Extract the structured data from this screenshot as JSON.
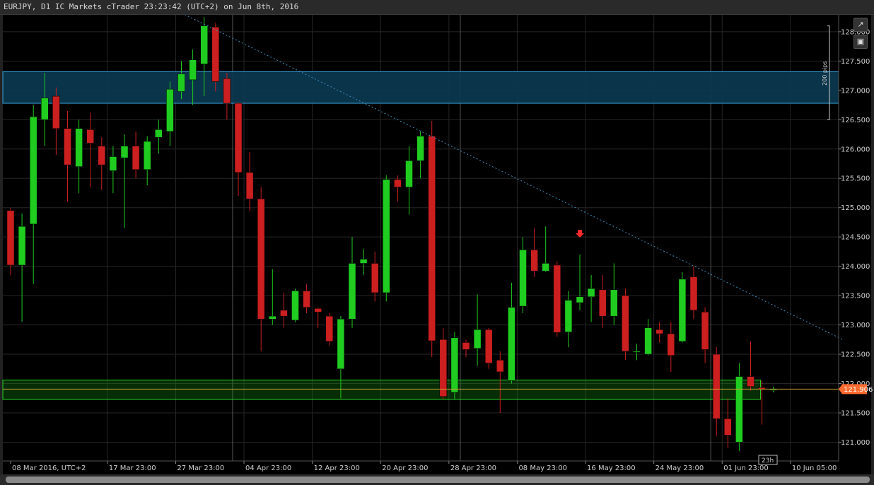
{
  "window": {
    "title": "EURJPY, D1 IC Markets cTrader 23:23:42 (UTC+2) on Jun 8th, 2016"
  },
  "toolbar": {
    "detach_icon": "external-link-icon",
    "camera_icon": "camera-icon"
  },
  "chart_data": {
    "type": "candlestick",
    "symbol": "EURJPY",
    "timeframe": "D1",
    "colors": {
      "background": "#000000",
      "bull": "#1fcc1f",
      "bear": "#cc1f1f",
      "grid": "#262626",
      "trendline": "#3f8fc0",
      "zone_blue": "#0b3a52",
      "zone_green": "#16a016",
      "price_tag": "#ff6a2e"
    },
    "ylim": [
      120.68,
      128.3
    ],
    "y_ticks": [
      "121.000",
      "121.500",
      "122.000",
      "122.500",
      "123.000",
      "123.500",
      "124.000",
      "124.500",
      "125.000",
      "125.500",
      "126.000",
      "126.500",
      "127.000",
      "127.500",
      "128.000",
      "128."
    ],
    "x_tick_labels": [
      {
        "label": "08 Mar 2016, UTC+2",
        "index": 0
      },
      {
        "label": "17 Mar 23:00",
        "index": 8.5
      },
      {
        "label": "27 Mar 23:00",
        "index": 14.5
      },
      {
        "label": "04 Apr 23:00",
        "index": 20.5
      },
      {
        "label": "12 Apr 23:00",
        "index": 26.5
      },
      {
        "label": "20 Apr 23:00",
        "index": 32.5
      },
      {
        "label": "28 Apr 23:00",
        "index": 38.5
      },
      {
        "label": "08 May 23:00",
        "index": 44.5
      },
      {
        "label": "16 May 23:00",
        "index": 50.5
      },
      {
        "label": "24 May 23:00",
        "index": 56.5
      },
      {
        "label": "01 Jun 23:00",
        "index": 62.5
      },
      {
        "label": "10 Jun 05:00",
        "index": 68.5
      }
    ],
    "period_separators": [
      19.5,
      39.5,
      61.5
    ],
    "candles": [
      {
        "o": 124.95,
        "h": 125.0,
        "l": 123.85,
        "c": 124.02
      },
      {
        "o": 124.02,
        "h": 124.9,
        "l": 123.05,
        "c": 124.68
      },
      {
        "o": 124.72,
        "h": 126.75,
        "l": 123.7,
        "c": 126.55
      },
      {
        "o": 126.5,
        "h": 127.3,
        "l": 126.05,
        "c": 126.87
      },
      {
        "o": 126.9,
        "h": 127.05,
        "l": 125.9,
        "c": 126.35
      },
      {
        "o": 126.35,
        "h": 126.65,
        "l": 125.1,
        "c": 125.73
      },
      {
        "o": 125.7,
        "h": 126.5,
        "l": 125.25,
        "c": 126.35
      },
      {
        "o": 126.33,
        "h": 126.62,
        "l": 125.35,
        "c": 126.1
      },
      {
        "o": 126.05,
        "h": 126.2,
        "l": 125.3,
        "c": 125.73
      },
      {
        "o": 125.63,
        "h": 126.05,
        "l": 125.25,
        "c": 125.87
      },
      {
        "o": 125.85,
        "h": 126.25,
        "l": 124.65,
        "c": 126.05
      },
      {
        "o": 126.05,
        "h": 126.3,
        "l": 125.5,
        "c": 125.65
      },
      {
        "o": 125.65,
        "h": 126.22,
        "l": 125.38,
        "c": 126.13
      },
      {
        "o": 126.2,
        "h": 126.5,
        "l": 125.92,
        "c": 126.33
      },
      {
        "o": 126.3,
        "h": 127.15,
        "l": 126.05,
        "c": 127.02
      },
      {
        "o": 126.98,
        "h": 127.5,
        "l": 126.85,
        "c": 127.28
      },
      {
        "o": 127.18,
        "h": 127.7,
        "l": 126.75,
        "c": 127.52
      },
      {
        "o": 127.45,
        "h": 128.25,
        "l": 126.9,
        "c": 128.1
      },
      {
        "o": 128.08,
        "h": 128.15,
        "l": 126.98,
        "c": 127.15
      },
      {
        "o": 127.2,
        "h": 127.3,
        "l": 126.5,
        "c": 126.78
      },
      {
        "o": 126.78,
        "h": 126.8,
        "l": 125.2,
        "c": 125.6
      },
      {
        "o": 125.6,
        "h": 125.95,
        "l": 124.95,
        "c": 125.15
      },
      {
        "o": 125.15,
        "h": 125.35,
        "l": 122.55,
        "c": 123.1
      },
      {
        "o": 123.1,
        "h": 123.95,
        "l": 123.0,
        "c": 123.15
      },
      {
        "o": 123.25,
        "h": 123.55,
        "l": 122.95,
        "c": 123.15
      },
      {
        "o": 123.08,
        "h": 123.62,
        "l": 123.05,
        "c": 123.58
      },
      {
        "o": 123.58,
        "h": 123.7,
        "l": 123.2,
        "c": 123.3
      },
      {
        "o": 123.28,
        "h": 123.3,
        "l": 122.95,
        "c": 123.22
      },
      {
        "o": 123.15,
        "h": 123.2,
        "l": 122.65,
        "c": 122.72
      },
      {
        "o": 122.25,
        "h": 123.15,
        "l": 121.75,
        "c": 123.1
      },
      {
        "o": 123.1,
        "h": 124.5,
        "l": 122.95,
        "c": 124.05
      },
      {
        "o": 124.05,
        "h": 124.3,
        "l": 123.85,
        "c": 124.12
      },
      {
        "o": 124.05,
        "h": 124.25,
        "l": 123.4,
        "c": 123.55
      },
      {
        "o": 123.55,
        "h": 125.55,
        "l": 123.4,
        "c": 125.48
      },
      {
        "o": 125.48,
        "h": 125.55,
        "l": 125.1,
        "c": 125.35
      },
      {
        "o": 125.35,
        "h": 126.05,
        "l": 124.88,
        "c": 125.8
      },
      {
        "o": 125.8,
        "h": 126.3,
        "l": 125.5,
        "c": 126.22
      },
      {
        "o": 126.22,
        "h": 126.48,
        "l": 122.45,
        "c": 122.73
      },
      {
        "o": 122.75,
        "h": 122.95,
        "l": 121.73,
        "c": 121.78
      },
      {
        "o": 121.85,
        "h": 122.88,
        "l": 121.73,
        "c": 122.78
      },
      {
        "o": 122.7,
        "h": 122.75,
        "l": 122.45,
        "c": 122.58
      },
      {
        "o": 122.6,
        "h": 123.52,
        "l": 122.3,
        "c": 122.92
      },
      {
        "o": 122.92,
        "h": 122.95,
        "l": 122.25,
        "c": 122.35
      },
      {
        "o": 122.4,
        "h": 122.55,
        "l": 121.5,
        "c": 122.2
      },
      {
        "o": 122.05,
        "h": 123.72,
        "l": 122.0,
        "c": 123.3
      },
      {
        "o": 123.32,
        "h": 124.5,
        "l": 123.2,
        "c": 124.28
      },
      {
        "o": 124.28,
        "h": 124.65,
        "l": 123.82,
        "c": 123.92
      },
      {
        "o": 123.92,
        "h": 124.68,
        "l": 123.9,
        "c": 124.05
      },
      {
        "o": 124.02,
        "h": 124.08,
        "l": 122.8,
        "c": 122.87
      },
      {
        "o": 122.88,
        "h": 123.58,
        "l": 122.62,
        "c": 123.42
      },
      {
        "o": 123.38,
        "h": 124.2,
        "l": 123.25,
        "c": 123.48
      },
      {
        "o": 123.48,
        "h": 123.85,
        "l": 123.05,
        "c": 123.62
      },
      {
        "o": 123.6,
        "h": 123.85,
        "l": 122.95,
        "c": 123.15
      },
      {
        "o": 123.15,
        "h": 124.05,
        "l": 123.0,
        "c": 123.6
      },
      {
        "o": 123.5,
        "h": 123.62,
        "l": 122.4,
        "c": 122.55
      },
      {
        "o": 122.55,
        "h": 122.68,
        "l": 122.4,
        "c": 122.55
      },
      {
        "o": 122.5,
        "h": 123.1,
        "l": 122.48,
        "c": 122.95
      },
      {
        "o": 122.92,
        "h": 123.05,
        "l": 122.7,
        "c": 122.85
      },
      {
        "o": 122.85,
        "h": 123.05,
        "l": 122.2,
        "c": 122.48
      },
      {
        "o": 122.72,
        "h": 123.9,
        "l": 122.7,
        "c": 123.78
      },
      {
        "o": 123.82,
        "h": 124.0,
        "l": 123.1,
        "c": 123.25
      },
      {
        "o": 123.22,
        "h": 123.3,
        "l": 122.35,
        "c": 122.58
      },
      {
        "o": 122.5,
        "h": 122.62,
        "l": 121.1,
        "c": 121.4
      },
      {
        "o": 121.4,
        "h": 121.75,
        "l": 120.9,
        "c": 121.12
      },
      {
        "o": 121.0,
        "h": 122.35,
        "l": 120.85,
        "c": 122.12
      },
      {
        "o": 122.12,
        "h": 122.72,
        "l": 121.88,
        "c": 121.95
      },
      {
        "o": 121.93,
        "h": 122.05,
        "l": 121.3,
        "c": 121.9
      },
      {
        "o": 121.9,
        "h": 121.95,
        "l": 121.85,
        "c": 121.906
      }
    ],
    "trendline": {
      "from": {
        "index": 10,
        "price": 128.8
      },
      "to": {
        "index": 73.2,
        "price": 122.74
      }
    },
    "zones": [
      {
        "name": "resistance-zone",
        "top": 127.32,
        "bottom": 126.78,
        "end_index": null
      },
      {
        "name": "support-zone",
        "top": 122.06,
        "bottom": 121.73,
        "end_index": 65.5
      }
    ],
    "level_line": 121.906,
    "current_price": {
      "label": "121.906",
      "value": 121.906
    },
    "sell_marker": {
      "index": 50,
      "price": 124.55
    },
    "ruler": {
      "label": "200 pips",
      "top": 128.1,
      "bottom": 126.5
    },
    "timer_label": "23h"
  }
}
